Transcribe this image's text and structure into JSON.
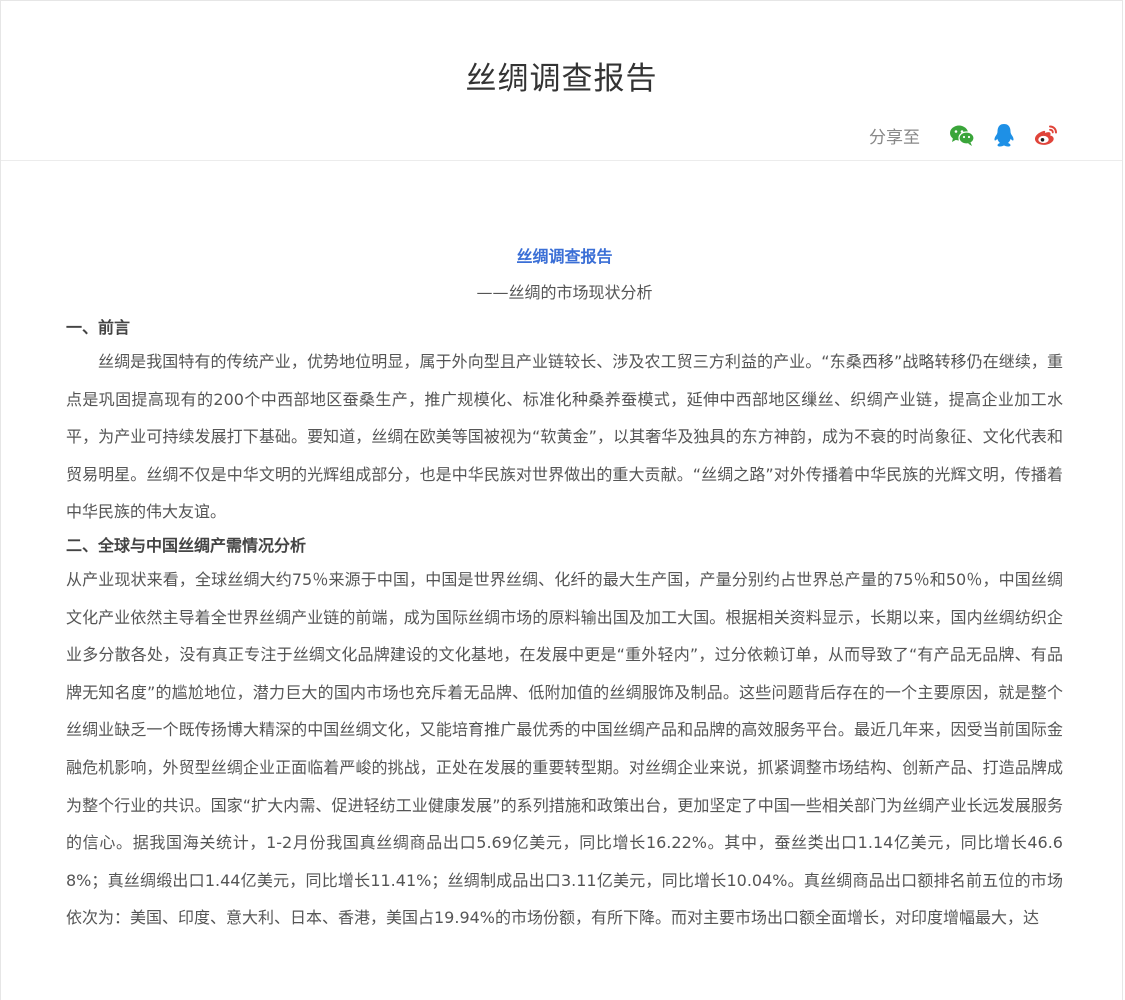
{
  "header": {
    "title": "丝绸调查报告",
    "share_label": "分享至"
  },
  "share_icons": [
    "wechat-icon",
    "qq-icon",
    "weibo-icon"
  ],
  "colors": {
    "accent_blue": "#3b6fd6",
    "wechat_green": "#3aa53a",
    "qq_blue": "#1e90e6",
    "weibo_red": "#e0443a"
  },
  "content": {
    "title": "丝绸调查报告",
    "subtitle": "——丝绸的市场现状分析",
    "section1_heading": "一、前言",
    "section1_para": "丝绸是我国特有的传统产业，优势地位明显，属于外向型且产业链较长、涉及农工贸三方利益的产业。“东桑西移”战略转移仍在继续，重点是巩固提高现有的200个中西部地区蚕桑生产，推广规模化、标准化种桑养蚕模式，延伸中西部地区缫丝、织绸产业链，提高企业加工水平，为产业可持续发展打下基础。要知道，丝绸在欧美等国被视为“软黄金”，以其奢华及独具的东方神韵，成为不衰的时尚象征、文化代表和贸易明星。丝绸不仅是中华文明的光辉组成部分，也是中华民族对世界做出的重大贡献。“丝绸之路”对外传播着中华民族的光辉文明，传播着中华民族的伟大友谊。",
    "section2_heading": "二、全球与中国丝绸产需情况分析",
    "section2_para": "从产业现状来看，全球丝绸大约75％来源于中国，中国是世界丝绸、化纤的最大生产国，产量分别约占世界总产量的75％和50％，中国丝绸文化产业依然主导着全世界丝绸产业链的前端，成为国际丝绸市场的原料输出国及加工大国。根据相关资料显示，长期以来，国内丝绸纺织企业多分散各处，没有真正专注于丝绸文化品牌建设的文化基地，在发展中更是“重外轻内”，过分依赖订单，从而导致了“有产品无品牌、有品牌无知名度”的尴尬地位，潜力巨大的国内市场也充斥着无品牌、低附加值的丝绸服饰及制品。这些问题背后存在的一个主要原因，就是整个丝绸业缺乏一个既传扬博大精深的中国丝绸文化，又能培育推广最优秀的中国丝绸产品和品牌的高效服务平台。最近几年来，因受当前国际金融危机影响，外贸型丝绸企业正面临着严峻的挑战，正处在发展的重要转型期。对丝绸企业来说，抓紧调整市场结构、创新产品、打造品牌成为整个行业的共识。国家“扩大内需、促进轻纺工业健康发展”的系列措施和政策出台，更加坚定了中国一些相关部门为丝绸产业长远发展服务的信心。据我国海关统计，1-2月份我国真丝绸商品出口5.69亿美元，同比增长16.22%。其中，蚕丝类出口1.14亿美元，同比增长46.68%；真丝绸缎出口1.44亿美元，同比增长11.41%；丝绸制成品出口3.11亿美元，同比增长10.04%。真丝绸商品出口额排名前五位的市场依次为：美国、印度、意大利、日本、香港，美国占19.94%的市场份额，有所下降。而对主要市场出口额全面增长，对印度增幅最大，达"
  }
}
